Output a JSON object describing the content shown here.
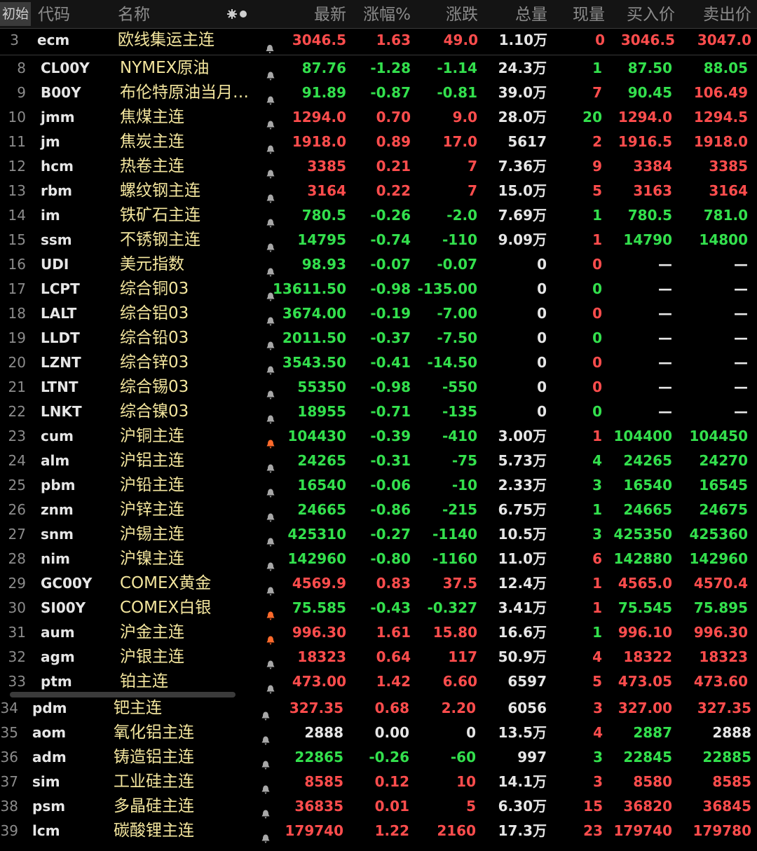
{
  "header": {
    "tab": "初始",
    "columns": [
      "代码",
      "名称",
      "最新",
      "涨幅%",
      "涨跌",
      "总量",
      "现量",
      "买入价",
      "卖出价"
    ],
    "settings_icon": "gear-icon"
  },
  "colors": {
    "up": "#ff4d4d",
    "down": "#33e04d",
    "neutral": "#e6e6e6",
    "name": "#f4e69e",
    "bell_active": "#ff6a2b",
    "bell": "#a8a8a8"
  },
  "pinned": {
    "n": "3",
    "code": "ecm",
    "name": "欧线集运主连",
    "bell": "bell-icon",
    "last": "3046.5",
    "pct": "1.63",
    "chg": "49.0",
    "vol": "1.10万",
    "cur": "0",
    "bid": "3046.5",
    "ask": "3047.0",
    "dir": "up",
    "cur_dir": "up"
  },
  "rows": [
    {
      "n": "8",
      "code": "CL00Y",
      "name": "NYMEX原油",
      "last": "87.76",
      "pct": "-1.28",
      "chg": "-1.14",
      "vol": "24.3万",
      "cur": "1",
      "bid": "87.50",
      "ask": "88.05",
      "dir": "dn",
      "cur_dir": "dn",
      "bid_dir": "dn",
      "ask_dir": "dn",
      "alert": false
    },
    {
      "n": "9",
      "code": "B00Y",
      "name": "布伦特原油当月…",
      "last": "91.89",
      "pct": "-0.87",
      "chg": "-0.81",
      "vol": "39.0万",
      "cur": "7",
      "bid": "90.45",
      "ask": "106.49",
      "dir": "dn",
      "cur_dir": "up",
      "bid_dir": "dn",
      "ask_dir": "up",
      "alert": false
    },
    {
      "n": "10",
      "code": "jmm",
      "name": "焦煤主连",
      "last": "1294.0",
      "pct": "0.70",
      "chg": "9.0",
      "vol": "28.0万",
      "cur": "20",
      "bid": "1294.0",
      "ask": "1294.5",
      "dir": "up",
      "cur_dir": "dn",
      "bid_dir": "up",
      "ask_dir": "up",
      "alert": false
    },
    {
      "n": "11",
      "code": "jm",
      "name": "焦炭主连",
      "last": "1918.0",
      "pct": "0.89",
      "chg": "17.0",
      "vol": "5617",
      "cur": "2",
      "bid": "1916.5",
      "ask": "1918.0",
      "dir": "up",
      "cur_dir": "up",
      "bid_dir": "up",
      "ask_dir": "up",
      "alert": false
    },
    {
      "n": "12",
      "code": "hcm",
      "name": "热卷主连",
      "last": "3385",
      "pct": "0.21",
      "chg": "7",
      "vol": "7.36万",
      "cur": "9",
      "bid": "3384",
      "ask": "3385",
      "dir": "up",
      "cur_dir": "up",
      "bid_dir": "up",
      "ask_dir": "up",
      "alert": false
    },
    {
      "n": "13",
      "code": "rbm",
      "name": "螺纹钢主连",
      "last": "3164",
      "pct": "0.22",
      "chg": "7",
      "vol": "15.0万",
      "cur": "5",
      "bid": "3163",
      "ask": "3164",
      "dir": "up",
      "cur_dir": "up",
      "bid_dir": "up",
      "ask_dir": "up",
      "alert": false
    },
    {
      "n": "14",
      "code": "im",
      "name": "铁矿石主连",
      "last": "780.5",
      "pct": "-0.26",
      "chg": "-2.0",
      "vol": "7.69万",
      "cur": "1",
      "bid": "780.5",
      "ask": "781.0",
      "dir": "dn",
      "cur_dir": "dn",
      "bid_dir": "dn",
      "ask_dir": "dn",
      "alert": false
    },
    {
      "n": "15",
      "code": "ssm",
      "name": "不锈钢主连",
      "last": "14795",
      "pct": "-0.74",
      "chg": "-110",
      "vol": "9.09万",
      "cur": "1",
      "bid": "14790",
      "ask": "14800",
      "dir": "dn",
      "cur_dir": "up",
      "bid_dir": "dn",
      "ask_dir": "dn",
      "alert": false
    },
    {
      "n": "16",
      "code": "UDI",
      "name": "美元指数",
      "last": "98.93",
      "pct": "-0.07",
      "chg": "-0.07",
      "vol": "0",
      "cur": "0",
      "bid": "—",
      "ask": "—",
      "dir": "dn",
      "cur_dir": "up",
      "bid_dir": "wh",
      "ask_dir": "wh",
      "alert": false
    },
    {
      "n": "17",
      "code": "LCPT",
      "name": "综合铜03",
      "last": "13611.50",
      "pct": "-0.98",
      "chg": "-135.00",
      "vol": "0",
      "cur": "0",
      "bid": "—",
      "ask": "—",
      "dir": "dn",
      "cur_dir": "dn",
      "bid_dir": "wh",
      "ask_dir": "wh",
      "alert": false
    },
    {
      "n": "18",
      "code": "LALT",
      "name": "综合铝03",
      "last": "3674.00",
      "pct": "-0.19",
      "chg": "-7.00",
      "vol": "0",
      "cur": "0",
      "bid": "—",
      "ask": "—",
      "dir": "dn",
      "cur_dir": "up",
      "bid_dir": "wh",
      "ask_dir": "wh",
      "alert": false
    },
    {
      "n": "19",
      "code": "LLDT",
      "name": "综合铅03",
      "last": "2011.50",
      "pct": "-0.37",
      "chg": "-7.50",
      "vol": "0",
      "cur": "0",
      "bid": "—",
      "ask": "—",
      "dir": "dn",
      "cur_dir": "dn",
      "bid_dir": "wh",
      "ask_dir": "wh",
      "alert": false
    },
    {
      "n": "20",
      "code": "LZNT",
      "name": "综合锌03",
      "last": "3543.50",
      "pct": "-0.41",
      "chg": "-14.50",
      "vol": "0",
      "cur": "0",
      "bid": "—",
      "ask": "—",
      "dir": "dn",
      "cur_dir": "up",
      "bid_dir": "wh",
      "ask_dir": "wh",
      "alert": false
    },
    {
      "n": "21",
      "code": "LTNT",
      "name": "综合锡03",
      "last": "55350",
      "pct": "-0.98",
      "chg": "-550",
      "vol": "0",
      "cur": "0",
      "bid": "—",
      "ask": "—",
      "dir": "dn",
      "cur_dir": "up",
      "bid_dir": "wh",
      "ask_dir": "wh",
      "alert": false
    },
    {
      "n": "22",
      "code": "LNKT",
      "name": "综合镍03",
      "last": "18955",
      "pct": "-0.71",
      "chg": "-135",
      "vol": "0",
      "cur": "0",
      "bid": "—",
      "ask": "—",
      "dir": "dn",
      "cur_dir": "dn",
      "bid_dir": "wh",
      "ask_dir": "wh",
      "alert": false
    },
    {
      "n": "23",
      "code": "cum",
      "name": "沪铜主连",
      "last": "104430",
      "pct": "-0.39",
      "chg": "-410",
      "vol": "3.00万",
      "cur": "1",
      "bid": "104400",
      "ask": "104450",
      "dir": "dn",
      "cur_dir": "up",
      "bid_dir": "dn",
      "ask_dir": "dn",
      "alert": true
    },
    {
      "n": "24",
      "code": "alm",
      "name": "沪铝主连",
      "last": "24265",
      "pct": "-0.31",
      "chg": "-75",
      "vol": "5.73万",
      "cur": "4",
      "bid": "24265",
      "ask": "24270",
      "dir": "dn",
      "cur_dir": "dn",
      "bid_dir": "dn",
      "ask_dir": "dn",
      "alert": false
    },
    {
      "n": "25",
      "code": "pbm",
      "name": "沪铅主连",
      "last": "16540",
      "pct": "-0.06",
      "chg": "-10",
      "vol": "2.33万",
      "cur": "3",
      "bid": "16540",
      "ask": "16545",
      "dir": "dn",
      "cur_dir": "dn",
      "bid_dir": "dn",
      "ask_dir": "dn",
      "alert": false
    },
    {
      "n": "26",
      "code": "znm",
      "name": "沪锌主连",
      "last": "24665",
      "pct": "-0.86",
      "chg": "-215",
      "vol": "6.75万",
      "cur": "1",
      "bid": "24665",
      "ask": "24675",
      "dir": "dn",
      "cur_dir": "dn",
      "bid_dir": "dn",
      "ask_dir": "dn",
      "alert": false
    },
    {
      "n": "27",
      "code": "snm",
      "name": "沪锡主连",
      "last": "425310",
      "pct": "-0.27",
      "chg": "-1140",
      "vol": "10.5万",
      "cur": "3",
      "bid": "425350",
      "ask": "425360",
      "dir": "dn",
      "cur_dir": "dn",
      "bid_dir": "dn",
      "ask_dir": "dn",
      "alert": false
    },
    {
      "n": "28",
      "code": "nim",
      "name": "沪镍主连",
      "last": "142960",
      "pct": "-0.80",
      "chg": "-1160",
      "vol": "11.0万",
      "cur": "6",
      "bid": "142880",
      "ask": "142960",
      "dir": "dn",
      "cur_dir": "up",
      "bid_dir": "dn",
      "ask_dir": "dn",
      "alert": false
    },
    {
      "n": "29",
      "code": "GC00Y",
      "name": "COMEX黄金",
      "last": "4569.9",
      "pct": "0.83",
      "chg": "37.5",
      "vol": "12.4万",
      "cur": "1",
      "bid": "4565.0",
      "ask": "4570.4",
      "dir": "up",
      "cur_dir": "up",
      "bid_dir": "up",
      "ask_dir": "up",
      "alert": false
    },
    {
      "n": "30",
      "code": "SI00Y",
      "name": "COMEX白银",
      "last": "75.585",
      "pct": "-0.43",
      "chg": "-0.327",
      "vol": "3.41万",
      "cur": "1",
      "bid": "75.545",
      "ask": "75.895",
      "dir": "dn",
      "cur_dir": "up",
      "bid_dir": "dn",
      "ask_dir": "dn",
      "alert": true
    },
    {
      "n": "31",
      "code": "aum",
      "name": "沪金主连",
      "last": "996.30",
      "pct": "1.61",
      "chg": "15.80",
      "vol": "16.6万",
      "cur": "1",
      "bid": "996.10",
      "ask": "996.30",
      "dir": "up",
      "cur_dir": "dn",
      "bid_dir": "up",
      "ask_dir": "up",
      "alert": true
    },
    {
      "n": "32",
      "code": "agm",
      "name": "沪银主连",
      "last": "18323",
      "pct": "0.64",
      "chg": "117",
      "vol": "50.9万",
      "cur": "4",
      "bid": "18322",
      "ask": "18323",
      "dir": "up",
      "cur_dir": "up",
      "bid_dir": "up",
      "ask_dir": "up",
      "alert": false
    },
    {
      "n": "33",
      "code": "ptm",
      "name": "铂主连",
      "last": "473.00",
      "pct": "1.42",
      "chg": "6.60",
      "vol": "6597",
      "cur": "5",
      "bid": "473.05",
      "ask": "473.60",
      "dir": "up",
      "cur_dir": "up",
      "bid_dir": "up",
      "ask_dir": "up",
      "alert": false
    }
  ],
  "rows_lower": [
    {
      "n": "34",
      "code": "pdm",
      "name": "钯主连",
      "last": "327.35",
      "pct": "0.68",
      "chg": "2.20",
      "vol": "6056",
      "cur": "3",
      "bid": "327.00",
      "ask": "327.35",
      "dir": "up",
      "cur_dir": "up",
      "bid_dir": "up",
      "ask_dir": "up",
      "alert": false
    },
    {
      "n": "35",
      "code": "aom",
      "name": "氧化铝主连",
      "last": "2888",
      "pct": "0.00",
      "chg": "0",
      "vol": "13.5万",
      "cur": "4",
      "bid": "2887",
      "ask": "2888",
      "dir": "wh",
      "cur_dir": "up",
      "bid_dir": "dn",
      "ask_dir": "wh",
      "alert": false
    },
    {
      "n": "36",
      "code": "adm",
      "name": "铸造铝主连",
      "last": "22865",
      "pct": "-0.26",
      "chg": "-60",
      "vol": "997",
      "cur": "3",
      "bid": "22845",
      "ask": "22885",
      "dir": "dn",
      "cur_dir": "dn",
      "bid_dir": "dn",
      "ask_dir": "dn",
      "alert": false
    },
    {
      "n": "37",
      "code": "sim",
      "name": "工业硅主连",
      "last": "8585",
      "pct": "0.12",
      "chg": "10",
      "vol": "14.1万",
      "cur": "3",
      "bid": "8580",
      "ask": "8585",
      "dir": "up",
      "cur_dir": "up",
      "bid_dir": "up",
      "ask_dir": "up",
      "alert": false
    },
    {
      "n": "38",
      "code": "psm",
      "name": "多晶硅主连",
      "last": "36835",
      "pct": "0.01",
      "chg": "5",
      "vol": "6.30万",
      "cur": "15",
      "bid": "36820",
      "ask": "36845",
      "dir": "up",
      "cur_dir": "up",
      "bid_dir": "up",
      "ask_dir": "up",
      "alert": false
    },
    {
      "n": "39",
      "code": "lcm",
      "name": "碳酸锂主连",
      "last": "179740",
      "pct": "1.22",
      "chg": "2160",
      "vol": "17.3万",
      "cur": "23",
      "bid": "179740",
      "ask": "179780",
      "dir": "up",
      "cur_dir": "up",
      "bid_dir": "up",
      "ask_dir": "up",
      "alert": false
    }
  ]
}
